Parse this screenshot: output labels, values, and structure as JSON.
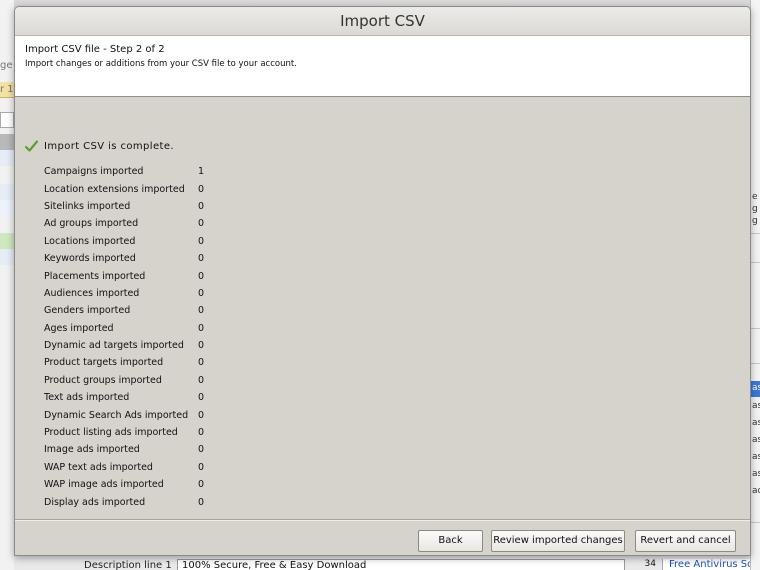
{
  "dialog": {
    "title": "Import CSV",
    "step_title": "Import CSV file - Step 2 of 2",
    "subtitle": "Import changes or additions from your CSV file to your account.",
    "status": "Import CSV is complete.",
    "status_icon": "checkmark-icon",
    "accent_check_color": "#5aa02c",
    "results": [
      {
        "label": "Campaigns imported",
        "value": "1"
      },
      {
        "label": "Location extensions imported",
        "value": "0"
      },
      {
        "label": "Sitelinks imported",
        "value": "0"
      },
      {
        "label": "Ad groups imported",
        "value": "0"
      },
      {
        "label": "Locations imported",
        "value": "0"
      },
      {
        "label": "Keywords imported",
        "value": "0"
      },
      {
        "label": "Placements imported",
        "value": "0"
      },
      {
        "label": "Audiences imported",
        "value": "0"
      },
      {
        "label": "Genders imported",
        "value": "0"
      },
      {
        "label": "Ages imported",
        "value": "0"
      },
      {
        "label": "Dynamic ad targets imported",
        "value": "0"
      },
      {
        "label": "Product targets imported",
        "value": "0"
      },
      {
        "label": "Product groups imported",
        "value": "0"
      },
      {
        "label": "Text ads imported",
        "value": "0"
      },
      {
        "label": "Dynamic Search Ads imported",
        "value": "0"
      },
      {
        "label": "Product listing ads imported",
        "value": "0"
      },
      {
        "label": "Image ads imported",
        "value": "0"
      },
      {
        "label": "WAP text ads imported",
        "value": "0"
      },
      {
        "label": "WAP image ads imported",
        "value": "0"
      },
      {
        "label": "Display ads imported",
        "value": "0"
      }
    ],
    "buttons": {
      "back": "Back",
      "review": "Review imported changes",
      "revert": "Revert and cancel"
    }
  },
  "background": {
    "left_fragments": [
      "ge",
      "r 1"
    ],
    "right_fragments": [
      "e",
      "g",
      "g"
    ],
    "right_list_fragments": [
      "as",
      "as",
      "as",
      "as",
      "as",
      "as",
      "ad"
    ],
    "description_label": "Description line 1",
    "description_value": "100% Secure, Free & Easy Download",
    "description_count": "34",
    "preview_text": "Free Antivirus Soft"
  }
}
